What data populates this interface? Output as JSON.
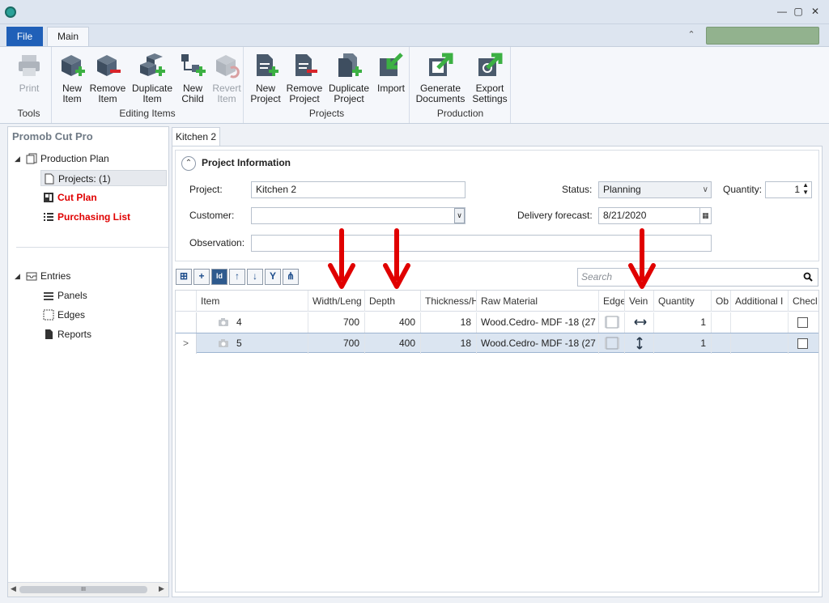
{
  "ribbon_tabs": {
    "file": "File",
    "main": "Main"
  },
  "ribbon_groups": [
    {
      "label": "Tools",
      "buttons": [
        {
          "label1": "Print",
          "label2": "",
          "icon": "printer-icon",
          "disabled": true
        }
      ]
    },
    {
      "label": "Editing Items",
      "buttons": [
        {
          "label1": "New",
          "label2": "Item",
          "icon": "new-item-icon"
        },
        {
          "label1": "Remove",
          "label2": "Item",
          "icon": "remove-item-icon"
        },
        {
          "label1": "Duplicate",
          "label2": "Item",
          "icon": "duplicate-item-icon"
        },
        {
          "label1": "New",
          "label2": "Child",
          "icon": "new-child-icon"
        },
        {
          "label1": "Revert",
          "label2": "Item",
          "icon": "revert-item-icon",
          "disabled": true
        }
      ]
    },
    {
      "label": "Projects",
      "buttons": [
        {
          "label1": "New",
          "label2": "Project",
          "icon": "new-project-icon"
        },
        {
          "label1": "Remove",
          "label2": "Project",
          "icon": "remove-project-icon"
        },
        {
          "label1": "Duplicate",
          "label2": "Project",
          "icon": "duplicate-project-icon"
        },
        {
          "label1": "Import",
          "label2": "",
          "icon": "import-icon"
        }
      ]
    },
    {
      "label": "Production",
      "buttons": [
        {
          "label1": "Generate",
          "label2": "Documents",
          "icon": "generate-documents-icon"
        },
        {
          "label1": "Export",
          "label2": "Settings",
          "icon": "export-settings-icon"
        }
      ]
    }
  ],
  "left_panel": {
    "title": "Promob Cut Pro",
    "tree": {
      "production_plan": "Production Plan",
      "projects": "Projects: (1)",
      "cut_plan": "Cut Plan",
      "purchasing_list": "Purchasing List",
      "entries": "Entries",
      "panels": "Panels",
      "edges": "Edges",
      "reports": "Reports"
    },
    "scroll_grip": "III"
  },
  "document_tab": "Kitchen 2",
  "project_info": {
    "title": "Project Information",
    "project_label": "Project:",
    "project_value": "Kitchen 2",
    "customer_label": "Customer:",
    "customer_value": "",
    "observation_label": "Observation:",
    "observation_value": "",
    "status_label": "Status:",
    "status_value": "Planning",
    "quantity_label": "Quantity:",
    "quantity_value": "1",
    "delivery_label": "Delivery forecast:",
    "delivery_value": "8/21/2020"
  },
  "toolbar": {
    "search_placeholder": "Search",
    "id_button": "Id"
  },
  "grid": {
    "columns": [
      "Item",
      "Width/Leng",
      "Depth",
      "Thickness/H",
      "Raw Material",
      "Edge",
      "Vein",
      "Quantity",
      "Ob",
      "Additional I",
      "Checl"
    ],
    "rows": [
      {
        "item": "4",
        "width": "700",
        "depth": "400",
        "thickness": "18",
        "material": "Wood.Cedro- MDF -18 (27",
        "vein": "horizontal",
        "quantity": "1",
        "selected": false
      },
      {
        "item": "5",
        "width": "700",
        "depth": "400",
        "thickness": "18",
        "material": "Wood.Cedro- MDF -18 (27",
        "vein": "vertical",
        "quantity": "1",
        "selected": true
      }
    ],
    "selected_row_marker": ">"
  },
  "colors": {
    "annotation_arrow": "#e00000",
    "file_tab": "#2060b8",
    "status_pill": "#92b28e",
    "selection": "#dbe5f1"
  }
}
